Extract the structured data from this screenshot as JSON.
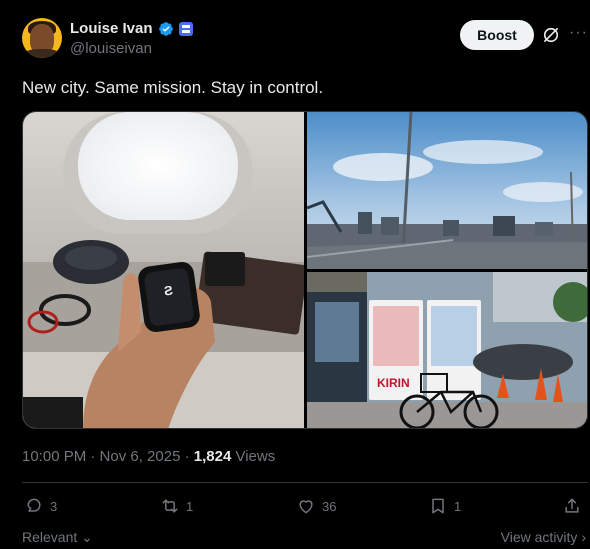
{
  "author": {
    "name": "Louise Ivan",
    "handle": "@louiseivan"
  },
  "header": {
    "boost_label": "Boost",
    "more_label": "···"
  },
  "tweet": {
    "text": "New city. Same mission. Stay in control."
  },
  "meta": {
    "time": "10:00 PM · Nov 6, 2025 · ",
    "views_count": "1,824",
    "views_label": " Views"
  },
  "actions": {
    "replies": "3",
    "reposts": "1",
    "likes": "36",
    "bookmarks": "1"
  },
  "footer": {
    "relevant": "Relevant",
    "view_activity": "View activity"
  },
  "media": {
    "sign_text": "KIRIN"
  },
  "colors": {
    "accent": "#1d9bf0",
    "boost_bg": "#eff3f4",
    "muted": "#71767b"
  }
}
